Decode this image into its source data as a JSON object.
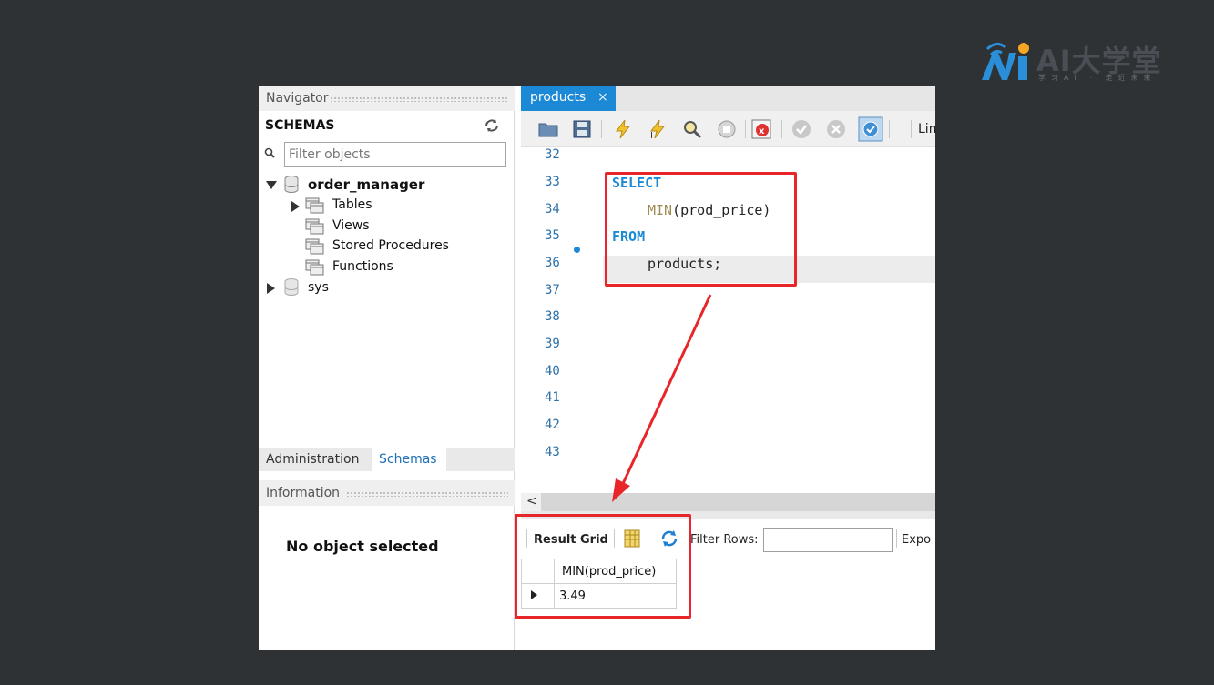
{
  "logo": {
    "text": "AI大学堂",
    "subtitle": "学习AI · 走近未来",
    "colors": {
      "blue": "#2a8fd8",
      "orange": "#f5a623"
    }
  },
  "navigator": {
    "title": "Navigator",
    "schemas_label": "SCHEMAS",
    "filter_placeholder": "Filter objects",
    "tree": [
      {
        "label": "order_manager",
        "expanded": true,
        "bold": true
      },
      {
        "label": "Tables"
      },
      {
        "label": "Views"
      },
      {
        "label": "Stored Procedures"
      },
      {
        "label": "Functions"
      },
      {
        "label": "sys",
        "expanded": false
      }
    ],
    "tabs": {
      "administration": "Administration",
      "schemas": "Schemas"
    },
    "info_title": "Information",
    "info_message": "No object selected"
  },
  "editor": {
    "tab_label": "products",
    "tab_close": "×",
    "limit_label": "Lim",
    "line_numbers": [
      "32",
      "33",
      "34",
      "35",
      "36",
      "37",
      "38",
      "39",
      "40",
      "41",
      "42",
      "43"
    ],
    "code": {
      "select": "SELECT",
      "min_fn": "MIN",
      "min_arg": "(prod_price)",
      "from": "FROM",
      "table": "products;"
    },
    "scroll_left": "<"
  },
  "results": {
    "grid_label": "Result Grid",
    "filter_label": "Filter Rows:",
    "export_label": "Expo",
    "column": "MIN(prod_price)",
    "value": "3.49"
  },
  "accent_colors": {
    "tab": "#1c89d6",
    "keyword": "#1a8ad4",
    "annotation": "#e8262a"
  }
}
